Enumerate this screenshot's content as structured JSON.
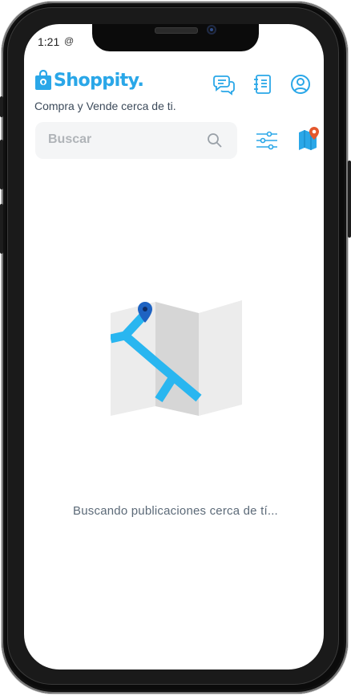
{
  "status_bar": {
    "time": "1:21",
    "icon": "at-sign-icon"
  },
  "header": {
    "brand": "Shoppity.",
    "tagline": "Compra y Vende cerca de ti.",
    "icons": [
      "chat-icon",
      "notebook-icon",
      "user-profile-icon"
    ]
  },
  "search": {
    "placeholder": "Buscar"
  },
  "toolbar": {
    "icons": [
      "filter-sliders-icon",
      "map-pin-icon"
    ]
  },
  "main": {
    "loading_text": "Buscando publicaciones cerca de tí..."
  },
  "colors": {
    "brand": "#2aa7e8",
    "accent_pin": "#e4582d",
    "route": "#29b6f0"
  }
}
